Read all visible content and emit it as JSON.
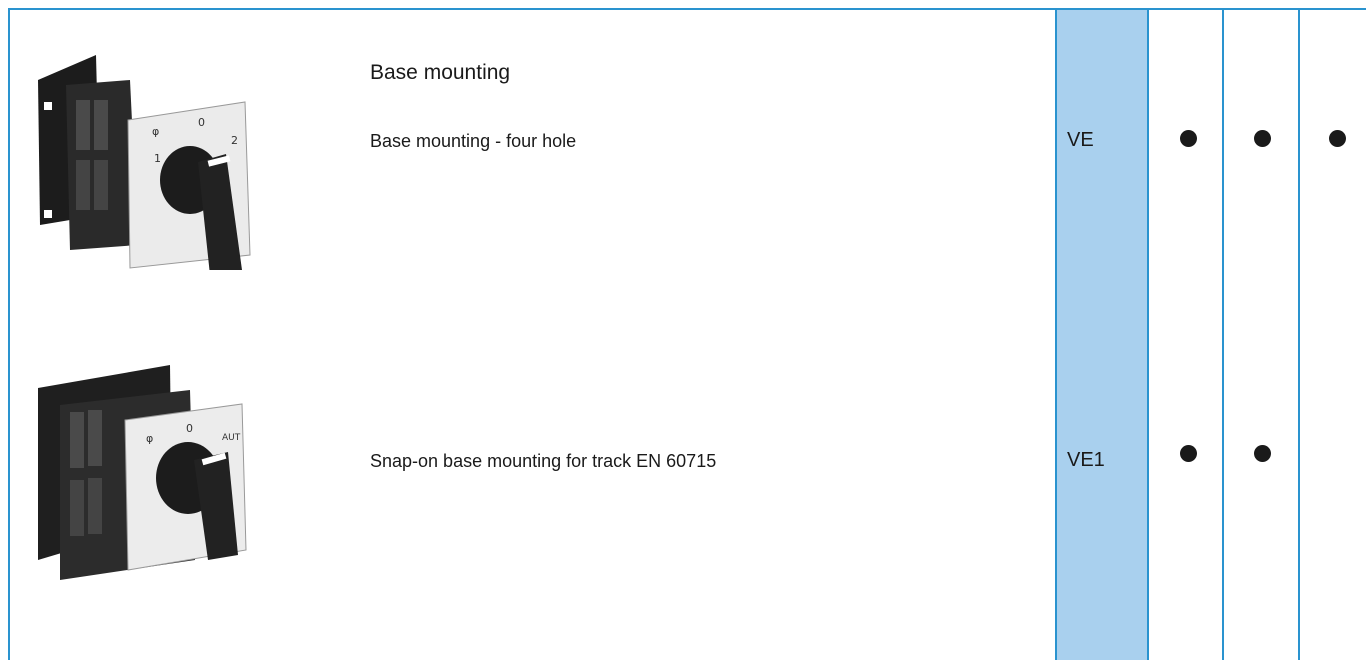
{
  "colors": {
    "border": "#2a93cf",
    "code_column": "#a9d0ee",
    "dot": "#1a1a1a"
  },
  "rows": [
    {
      "image": "rotary-switch-four-hole-base",
      "title": "Base mounting",
      "description": "Base mounting - four hole",
      "code": "VE",
      "availability": [
        true,
        true,
        true
      ]
    },
    {
      "image": "rotary-switch-snap-on-base",
      "title": "",
      "description": "Snap-on base mounting for track EN 60715",
      "code": "VE1",
      "availability": [
        true,
        true,
        false
      ]
    }
  ]
}
